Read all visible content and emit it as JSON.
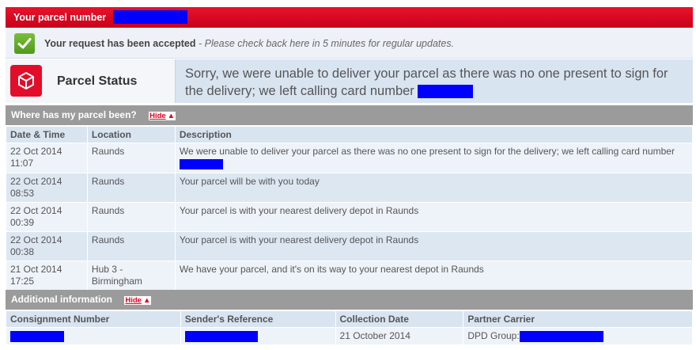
{
  "header": {
    "parcel_label": "Your parcel number"
  },
  "accepted": {
    "bold_text": "Your request has been accepted",
    "italic_text": " - Please check back here in 5 minutes for regular updates."
  },
  "status": {
    "title": "Parcel Status",
    "message": "Sorry, we were unable to deliver your parcel as there was no one present to sign for the delivery; we left calling card number"
  },
  "history": {
    "title": "Where has my parcel been?",
    "hide_label": "Hide",
    "columns": [
      "Date & Time",
      "Location",
      "Description"
    ],
    "rows": [
      {
        "date": "22 Oct 2014",
        "time": "11:07",
        "loc1": "Raunds",
        "loc2": "",
        "desc": "We were unable to deliver your parcel as there was no one present to sign for the delivery; we left calling card number"
      },
      {
        "date": "22 Oct 2014",
        "time": "08:53",
        "loc1": "Raunds",
        "loc2": "",
        "desc": "Your parcel will be with you today"
      },
      {
        "date": "22 Oct 2014",
        "time": "00:39",
        "loc1": "Raunds",
        "loc2": "",
        "desc": "Your parcel is with your nearest delivery depot in Raunds"
      },
      {
        "date": "22 Oct 2014",
        "time": "00:38",
        "loc1": "Raunds",
        "loc2": "",
        "desc": "Your parcel is with your nearest delivery depot in Raunds"
      },
      {
        "date": "21 Oct 2014",
        "time": "17:25",
        "loc1": "Hub 3 -",
        "loc2": "Birmingham",
        "desc": "We have your parcel, and it's on its way to your nearest depot in Raunds"
      }
    ]
  },
  "additional": {
    "title": "Additional information",
    "hide_label": "Hide",
    "columns": [
      "Consignment Number",
      "Sender's Reference",
      "Collection Date",
      "Partner Carrier"
    ],
    "collection_date": "21 October 2014",
    "partner_carrier": "DPD Group:"
  },
  "colors": {
    "brand_red": "#e30d2a",
    "redaction": "#0000ff",
    "section_grey": "#9b9b9b"
  },
  "icons": [
    "check-icon",
    "parcel-box-icon",
    "triangle-up-icon"
  ]
}
